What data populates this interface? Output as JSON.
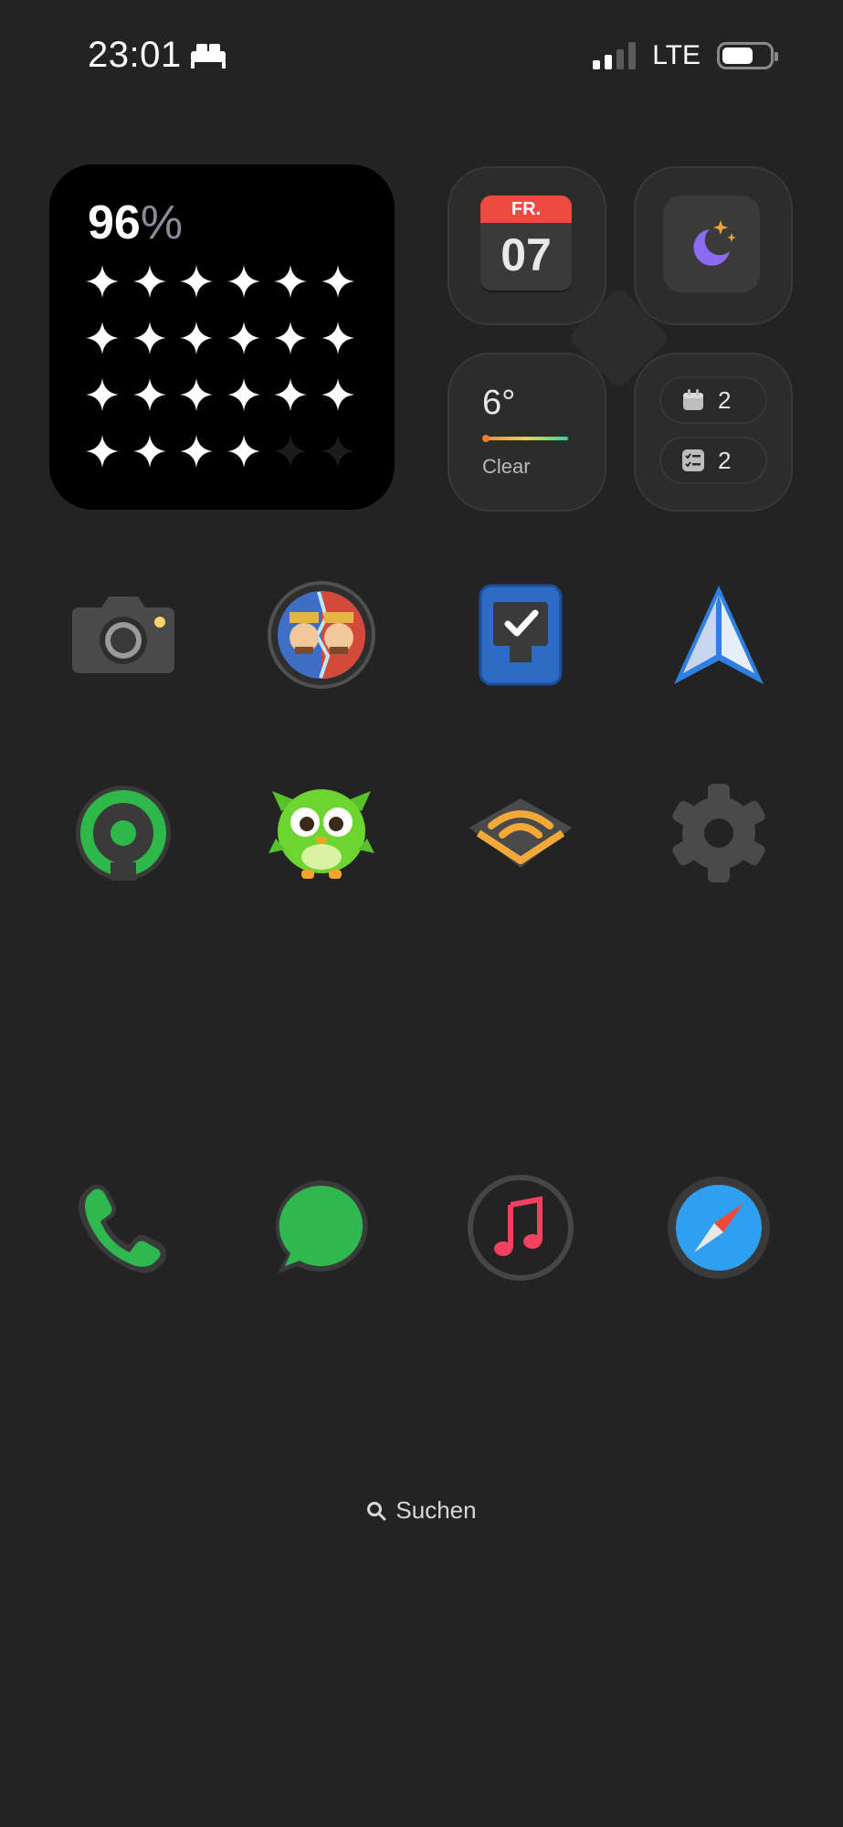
{
  "status_bar": {
    "time": "23:01",
    "sleep_icon": "bed-icon",
    "carrier": "LTE",
    "signal_bars_active": 2,
    "signal_bars_total": 4,
    "battery_level": 0.65
  },
  "sleep_widget": {
    "score_value": "96",
    "score_symbol": "%",
    "stars_total": 24,
    "stars_filled": 22
  },
  "cluster_widget": {
    "calendar": {
      "weekday": "FR.",
      "day": "07"
    },
    "moon_icon": "moon-stars-icon",
    "weather": {
      "temperature": "6°",
      "condition": "Clear"
    },
    "events_count": "2",
    "reminders_count": "2"
  },
  "apps_row1": [
    {
      "name": "camera-app",
      "icon": "camera-icon"
    },
    {
      "name": "clash-royale-app",
      "icon": "game-icon"
    },
    {
      "name": "todo-app",
      "icon": "checkbox-icon"
    },
    {
      "name": "spark-mail-app",
      "icon": "paper-plane-icon"
    }
  ],
  "apps_row2": [
    {
      "name": "location-app",
      "icon": "location-ring-icon"
    },
    {
      "name": "duolingo-app",
      "icon": "owl-icon"
    },
    {
      "name": "audible-app",
      "icon": "audible-icon"
    },
    {
      "name": "settings-app",
      "icon": "gear-icon"
    }
  ],
  "dock": [
    {
      "name": "phone-app",
      "icon": "phone-icon"
    },
    {
      "name": "messages-app",
      "icon": "message-bubble-icon"
    },
    {
      "name": "music-app",
      "icon": "music-note-icon"
    },
    {
      "name": "safari-app",
      "icon": "compass-icon"
    }
  ],
  "search": {
    "label": "Suchen"
  },
  "colors": {
    "background": "#232323",
    "calendar_red": "#ef4a3f",
    "moon_purple": "#8b6cf0",
    "green": "#2fb84a",
    "safari_blue": "#2f9ff0",
    "music_pink": "#f2405e"
  }
}
